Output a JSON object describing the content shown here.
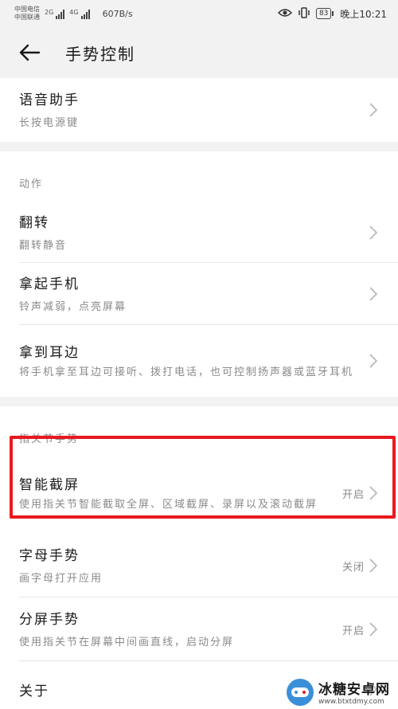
{
  "status_bar": {
    "carrier_1": "中国电信",
    "carrier_2": "中国联通",
    "network_1": "2G",
    "network_2": "4G",
    "net_speed": "607B/s",
    "battery": "83",
    "time": "晚上10:21"
  },
  "header": {
    "title": "手势控制",
    "back_icon": "back-arrow-icon"
  },
  "voice": {
    "title": "语音助手",
    "subtitle": "长按电源键"
  },
  "actions": {
    "section_label": "动作",
    "items": [
      {
        "title": "翻转",
        "subtitle": "翻转静音"
      },
      {
        "title": "拿起手机",
        "subtitle": "铃声减弱，点亮屏幕"
      },
      {
        "title": "拿到耳边",
        "subtitle": "将手机拿至耳边可接听、拨打电话，也可控制扬声器或蓝牙耳机"
      }
    ]
  },
  "knuckle": {
    "section_label": "指关节手势",
    "items": [
      {
        "title": "智能截屏",
        "subtitle": "使用指关节智能截取全屏、区域截屏、录屏以及滚动截屏",
        "value": "开启"
      },
      {
        "title": "字母手势",
        "subtitle": "画字母打开应用",
        "value": "关闭"
      },
      {
        "title": "分屏手势",
        "subtitle": "使用指关节在屏幕中间画直线，启动分屏",
        "value": "开启"
      },
      {
        "title": "关于",
        "subtitle": "",
        "value": ""
      }
    ]
  },
  "highlight_color": "#e8191f",
  "watermark": {
    "title": "冰糖安卓网",
    "url": "www.btxtdmy.com"
  }
}
